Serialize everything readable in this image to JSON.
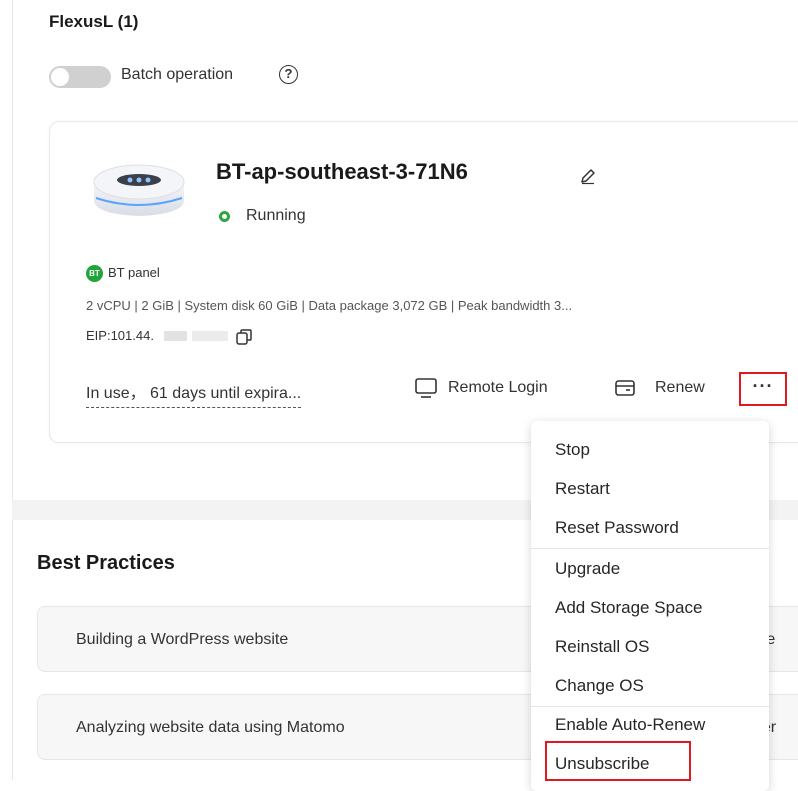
{
  "section": {
    "title": "FlexusL (1)",
    "batch_operation_label": "Batch operation",
    "help_glyph": "?"
  },
  "server": {
    "name": "BT-ap-southeast-3-71N6",
    "status": "Running",
    "status_color": "#2da641",
    "panel_badge": "BT",
    "panel_label": "BT panel",
    "specs": "2 vCPU | 2 GiB | System disk 60 GiB | Data package 3,072 GB | Peak bandwidth 3...",
    "eip": "EIP:101.44.",
    "expiry": "In use， 61 days until expira...",
    "actions": {
      "remote_login": "Remote Login",
      "renew": "Renew",
      "more": "···"
    }
  },
  "more_menu": {
    "items": [
      "Stop",
      "Restart",
      "Reset Password",
      "Upgrade",
      "Add Storage Space",
      "Reinstall OS",
      "Change OS",
      "Enable Auto-Renew",
      "Unsubscribe"
    ]
  },
  "best_practices": {
    "title": "Best Practices",
    "items": [
      {
        "label": "Building a WordPress website",
        "tail": "rve"
      },
      {
        "label": "Analyzing website data using Matomo",
        "tail": "ner"
      }
    ]
  },
  "icons": {
    "edit": "pencil-icon",
    "copy": "copy-icon",
    "remote": "monitor-icon",
    "renew": "wallet-icon",
    "help": "question-circle-icon"
  },
  "colors": {
    "highlight": "#e0191e",
    "running": "#2da641",
    "bt_brand": "#20a53a"
  }
}
